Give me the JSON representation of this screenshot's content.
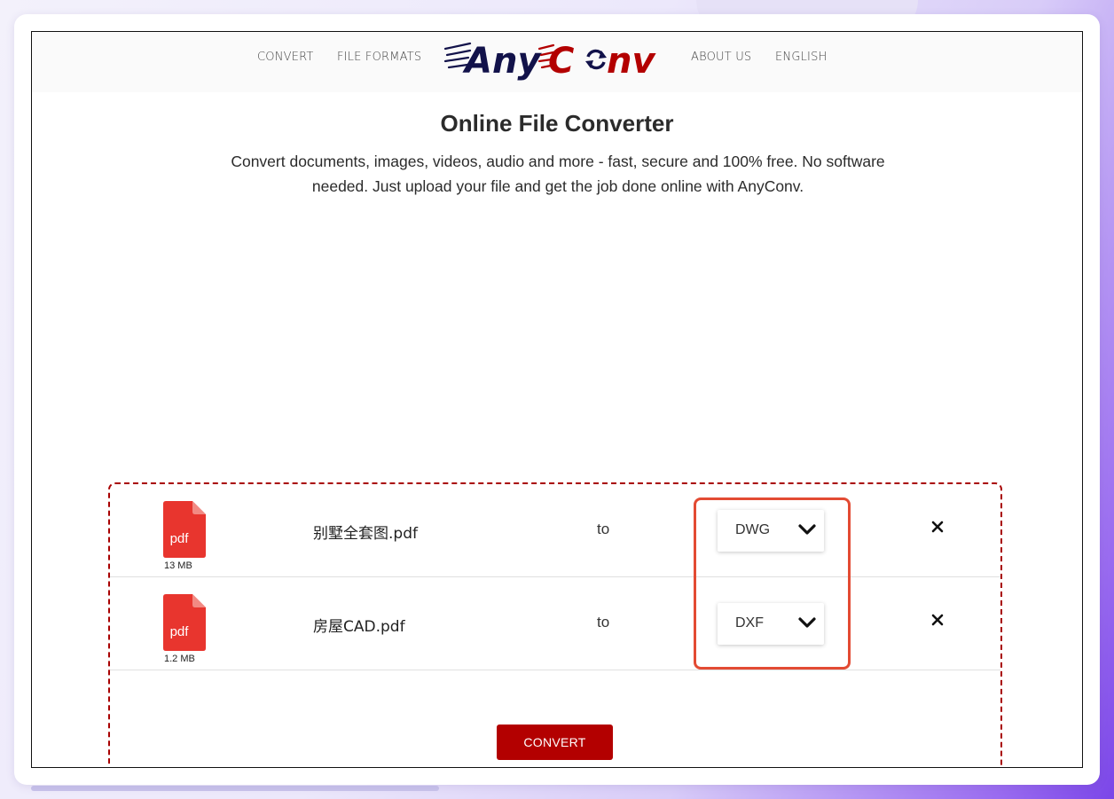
{
  "nav": {
    "convert": "CONVERT",
    "file_formats": "FILE FORMATS",
    "logo_text": "AnyConv",
    "about": "ABOUT US",
    "language": "ENGLISH"
  },
  "hero": {
    "title": "Online File Converter",
    "subtitle": "Convert documents, images, videos, audio and more - fast, secure and 100% free. No software needed. Just upload your file and get the job done online with AnyConv."
  },
  "files": [
    {
      "icon_label": "pdf",
      "size": "13 MB",
      "name": "别墅全套图.pdf",
      "to": "to",
      "target_format": "DWG"
    },
    {
      "icon_label": "pdf",
      "size": "1.2 MB",
      "name": "房屋CAD.pdf",
      "to": "to",
      "target_format": "DXF"
    }
  ],
  "actions": {
    "convert_label": "CONVERT"
  },
  "colors": {
    "brand_red": "#b30000",
    "brand_navy": "#12124a",
    "pdf_red": "#e8352e",
    "highlight": "#e34b33",
    "dropzone_border": "#a80000"
  },
  "icons": {
    "file": "pdf-file-icon",
    "chevron": "chevron-down-icon",
    "remove": "close-icon"
  }
}
